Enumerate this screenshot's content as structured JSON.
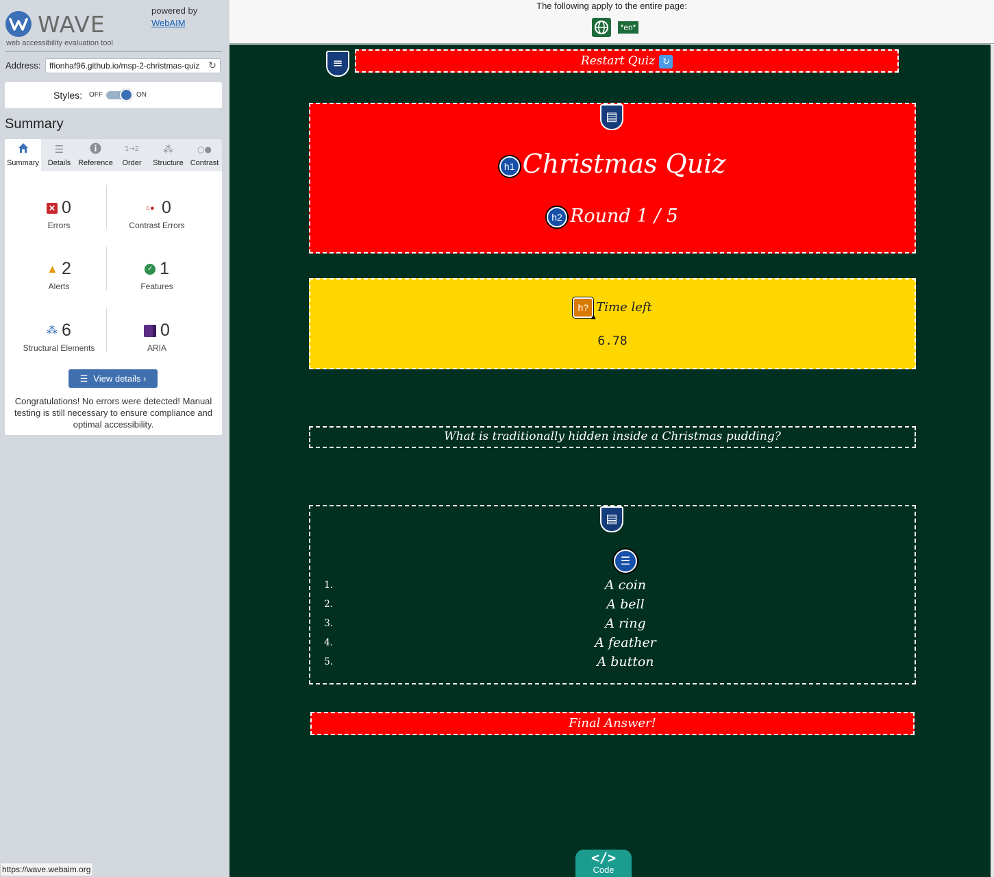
{
  "brand": {
    "name": "WAVE",
    "tagline": "web accessibility evaluation tool",
    "powered_by": "powered by",
    "powered_link": "WebAIM"
  },
  "address": {
    "label": "Address:",
    "value": "ffionhaf96.github.io/msp-2-christmas-quiz"
  },
  "styles_toggle": {
    "label": "Styles:",
    "off": "OFF",
    "on": "ON",
    "state": "on"
  },
  "summary": {
    "title": "Summary",
    "tabs": [
      {
        "label": "Summary",
        "icon": "home-icon"
      },
      {
        "label": "Details",
        "icon": "list-icon"
      },
      {
        "label": "Reference",
        "icon": "info-icon"
      },
      {
        "label": "Order",
        "icon": "order-icon"
      },
      {
        "label": "Structure",
        "icon": "structure-icon"
      },
      {
        "label": "Contrast",
        "icon": "contrast-icon"
      }
    ],
    "stats": {
      "errors": {
        "count": "0",
        "label": "Errors"
      },
      "contrast_errors": {
        "count": "0",
        "label": "Contrast Errors"
      },
      "alerts": {
        "count": "2",
        "label": "Alerts"
      },
      "features": {
        "count": "1",
        "label": "Features"
      },
      "structural": {
        "count": "6",
        "label": "Structural Elements"
      },
      "aria": {
        "count": "0",
        "label": "ARIA"
      }
    },
    "view_details": "View details ›",
    "message": "Congratulations! No errors were detected! Manual testing is still necessary to ensure compliance and optimal accessibility."
  },
  "status_bar": {
    "url": "https://wave.webaim.org"
  },
  "page_banner": {
    "text": "The following apply to the entire page:",
    "lang_badge": "*en*"
  },
  "quiz": {
    "restart_label": "Restart Quiz",
    "title": "Christmas Quiz",
    "round": "Round 1 / 5",
    "h1_badge": "h1",
    "h2_badge": "h2",
    "h_alert_badge": "h?",
    "timer_label": "Time left",
    "timer_value": "6.78",
    "question": "What is traditionally hidden inside a Christmas pudding?",
    "answers": [
      {
        "num": "1.",
        "text": "A coin"
      },
      {
        "num": "2.",
        "text": "A bell"
      },
      {
        "num": "3.",
        "text": "A ring"
      },
      {
        "num": "4.",
        "text": "A feather"
      },
      {
        "num": "5.",
        "text": "A button"
      }
    ],
    "final_answer": "Final Answer!"
  },
  "code_tab": {
    "label": "Code",
    "icon": "</>"
  },
  "colors": {
    "page_background": "#023020",
    "quiz_red": "#ff0000",
    "timer_yellow": "#ffd700",
    "wave_blue": "#3b6fb6"
  }
}
